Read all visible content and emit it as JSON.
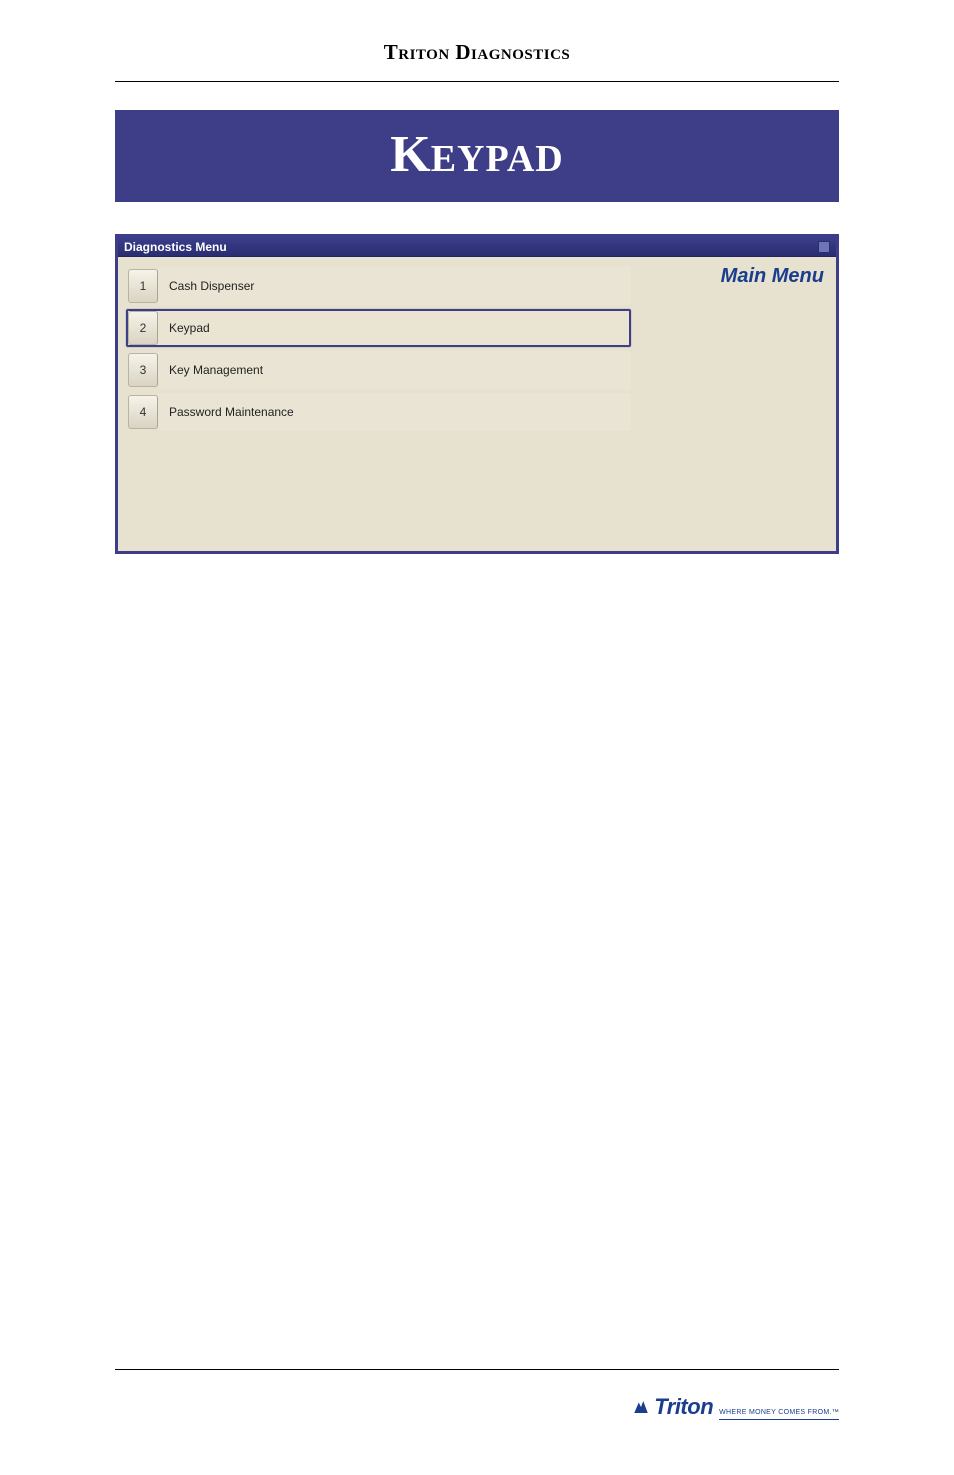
{
  "doc_header": "Triton Diagnostics",
  "banner": {
    "cap": "K",
    "rest": "EYPAD"
  },
  "window": {
    "title": "Diagnostics Menu",
    "right_label": "Main Menu",
    "items": [
      {
        "num": "1",
        "label": "Cash Dispenser",
        "selected": false
      },
      {
        "num": "2",
        "label": "Keypad",
        "selected": true
      },
      {
        "num": "3",
        "label": "Key Management",
        "selected": false
      },
      {
        "num": "4",
        "label": "Password Maintenance",
        "selected": false
      }
    ]
  },
  "brand": {
    "name": "Triton",
    "tagline": "WHERE MONEY COMES FROM.™"
  }
}
